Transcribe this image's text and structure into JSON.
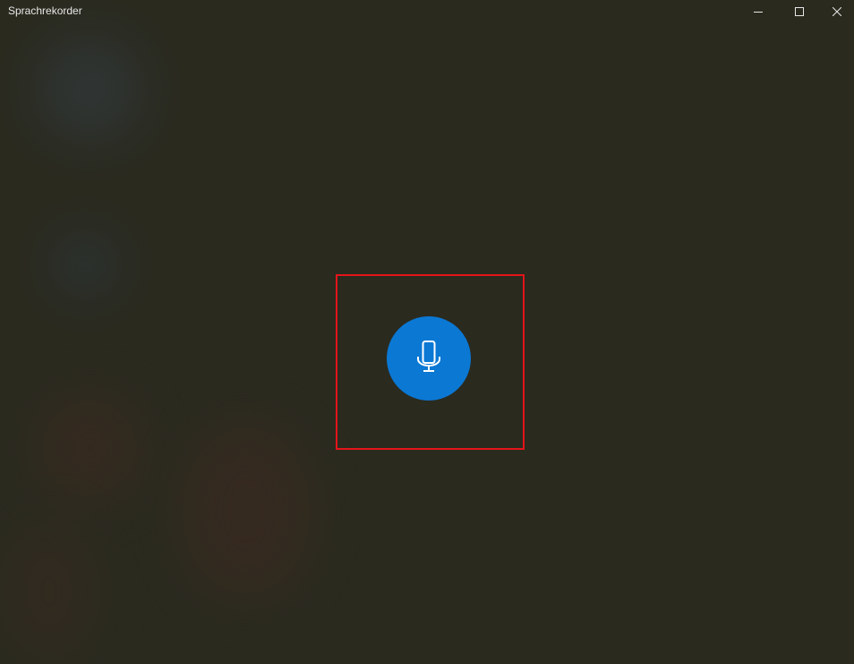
{
  "window": {
    "title": "Sprachrekorder"
  },
  "caption_buttons": {
    "minimize_icon": "minimize-icon",
    "maximize_icon": "maximize-icon",
    "close_icon": "close-icon"
  },
  "main": {
    "record_button_icon": "microphone-icon"
  },
  "colors": {
    "background": "#2a2a1f",
    "accent": "#0b78d4",
    "highlight_border": "#e3141a",
    "title_text": "#e8e8e8"
  }
}
